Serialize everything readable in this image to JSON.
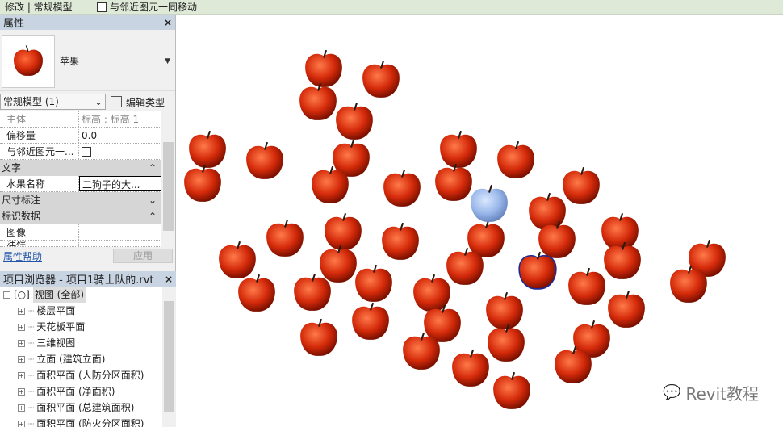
{
  "toolbar": {
    "context": "修改 | 常规模型",
    "move_with_nearby": "与邻近图元一同移动"
  },
  "properties": {
    "title": "属性",
    "close": "×",
    "type_name": "苹果",
    "selector": "常规模型 (1)",
    "edit_type": "编辑类型",
    "rows": [
      {
        "key": "主体",
        "value": "标高 : 标高 1"
      },
      {
        "key": "偏移量",
        "value": "0.0"
      },
      {
        "key": "与邻近图元一...",
        "value": ""
      }
    ],
    "groups": {
      "text": "文字",
      "dimensions": "尺寸标注",
      "identity": "标识数据"
    },
    "fruit_name": {
      "key": "水果名称",
      "value": "二狗子的大..."
    },
    "image": {
      "key": "图像",
      "value": ""
    },
    "comment_partial": "注释",
    "help": "属性帮助",
    "apply": "应用"
  },
  "browser": {
    "title": "项目浏览器 - 项目1骑士队的.rvt",
    "close": "×",
    "root": "视图 (全部)",
    "items": [
      "楼层平面",
      "天花板平面",
      "三维视图",
      "立面 (建筑立面)",
      "面积平面 (人防分区面积)",
      "面积平面 (净面积)",
      "面积平面 (总建筑面积)",
      "面积平面 (防火分区面积)"
    ]
  },
  "watermark": "Revit教程",
  "colors": {
    "apple": "#d42a0a",
    "apple_selected": "#9ab8ea",
    "panel_header": "#c8d4e2"
  }
}
